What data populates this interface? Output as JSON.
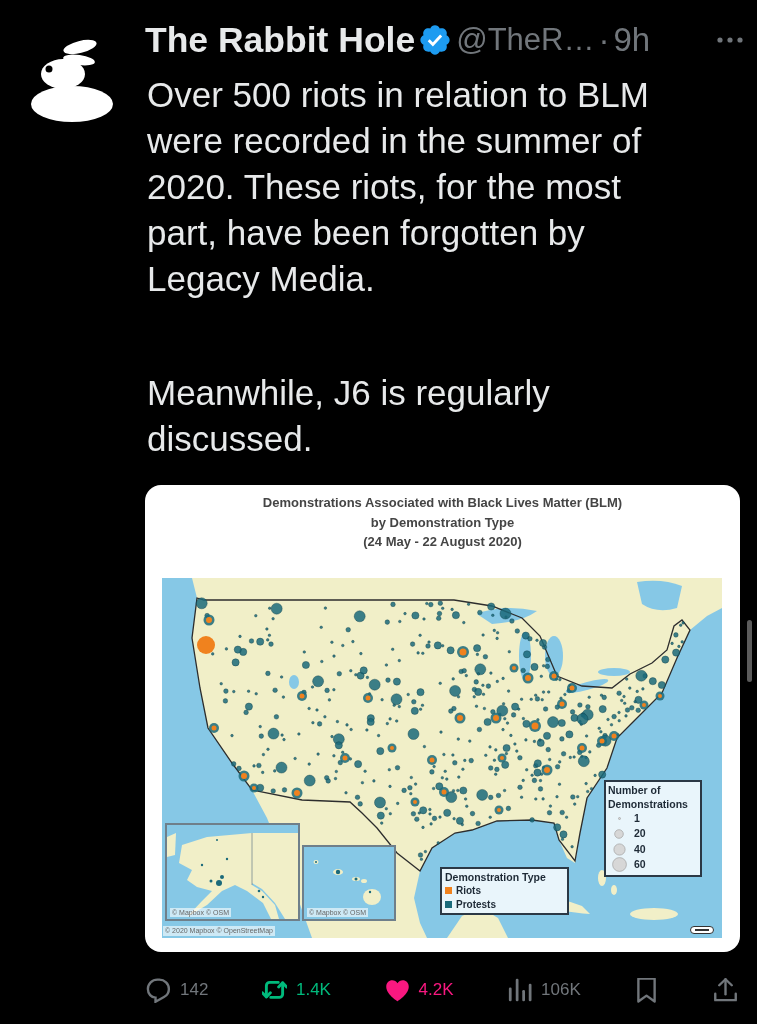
{
  "post": {
    "author": {
      "name": "The Rabbit Hole",
      "verified": true,
      "handle": "@TheR…",
      "separator": "·",
      "time": "9h"
    },
    "text": [
      "Over 500 riots in relation to BLM were recorded in the summer of 2020. These riots, for the most part, have been forgotten by Legacy Media.",
      "Meanwhile, J6 is regularly discussed."
    ],
    "image": {
      "title_lines": [
        "Demonstrations Associated with Black Lives Matter (BLM)",
        "by Demonstration Type",
        "(24 May - 22 August 2020)"
      ],
      "size_legend": {
        "title": "Number of Demonstrations",
        "items": [
          "1",
          "20",
          "40",
          "60"
        ]
      },
      "type_legend": {
        "title": "Demonstration Type",
        "items": [
          {
            "label": "Riots",
            "color": "#f0821e"
          },
          {
            "label": "Protests",
            "color": "#1b6a7a"
          }
        ]
      },
      "alaska_inset": {
        "attribution": "© Mapbox © OSM"
      },
      "hawaii_inset": {
        "attribution": "© Mapbox © OSM"
      },
      "attribution": "© 2020 Mapbox © OpenStreetMap"
    },
    "actions": [
      {
        "kind": "reply",
        "count": "142"
      },
      {
        "kind": "repost",
        "count": "1.4K",
        "on": true
      },
      {
        "kind": "like",
        "count": "4.2K",
        "on": true
      },
      {
        "kind": "views",
        "count": "106K"
      },
      {
        "kind": "bookmark",
        "on": false
      },
      {
        "kind": "share"
      }
    ]
  }
}
